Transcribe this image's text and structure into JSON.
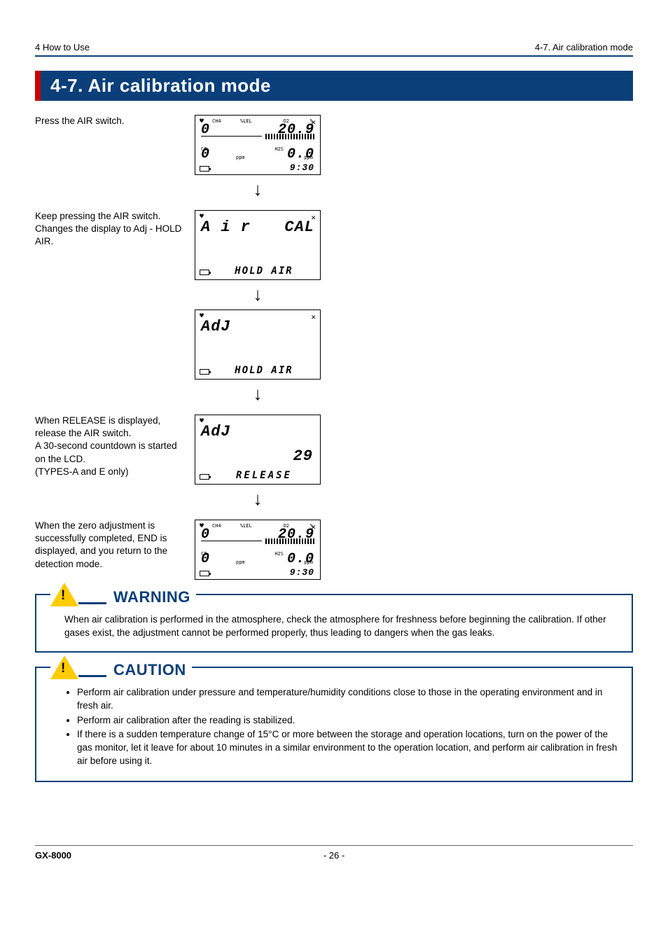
{
  "header": {
    "left": "4 How to Use",
    "right": "4-7. Air calibration mode"
  },
  "section_title": "4-7. Air calibration mode",
  "steps": [
    {
      "text": "Press the AIR switch."
    },
    {
      "text": "Keep pressing the AIR switch. Changes the display to Adj - HOLD AIR."
    },
    {
      "text": "When RELEASE is displayed, release the AIR switch.\nA 30-second countdown is started on the LCD.\n(TYPES-A and E only)"
    },
    {
      "text": "When the zero adjustment is successfully completed, END is displayed, and you return to the detection mode."
    }
  ],
  "lcd": {
    "screen1": {
      "ch4_label": "CH4",
      "lel_label": "%LEL",
      "o2_label": "O2",
      "pct_label": "%",
      "ch4_val": "0",
      "o2_val": "20.9",
      "co_label": "CO",
      "ppm1": "ppm",
      "h2s_label": "H2S",
      "ppm2": "ppm",
      "co_val": "0",
      "h2s_val": "0.0",
      "time": "9:30"
    },
    "screen2": {
      "line1_left": "A i r",
      "line1_right": "CAL",
      "msg": "HOLD  AIR"
    },
    "screen3": {
      "line1": "AdJ",
      "msg": "HOLD  AIR"
    },
    "screen4": {
      "line1": "AdJ",
      "count": "29",
      "msg": "RELEASE"
    },
    "screen5": {
      "ch4_label": "CH4",
      "lel_label": "%LEL",
      "o2_label": "O2",
      "pct_label": "%",
      "ch4_val": "0",
      "o2_val": "20.9",
      "co_label": "CO",
      "ppm1": "ppm",
      "h2s_label": "H2S",
      "ppm2": "ppm",
      "co_val": "0",
      "h2s_val": "0.0",
      "time": "9:30"
    }
  },
  "warning": {
    "title": "WARNING",
    "body": "When air calibration is performed in the atmosphere, check the atmosphere for freshness before beginning the calibration. If other gases exist, the adjustment cannot be performed properly, thus leading to dangers when the gas leaks."
  },
  "caution": {
    "title": "CAUTION",
    "items": [
      "Perform air calibration under pressure and temperature/humidity conditions close to those in the operating environment and in fresh air.",
      "Perform air calibration after the reading is stabilized.",
      "If there is a sudden temperature change of 15°C or more between the storage and operation locations, turn on the power of the gas monitor, let it leave for about 10 minutes in a similar environment to the operation location, and perform air calibration in fresh air before using it."
    ]
  },
  "footer": {
    "model": "GX-8000",
    "page": "- 26 -"
  }
}
